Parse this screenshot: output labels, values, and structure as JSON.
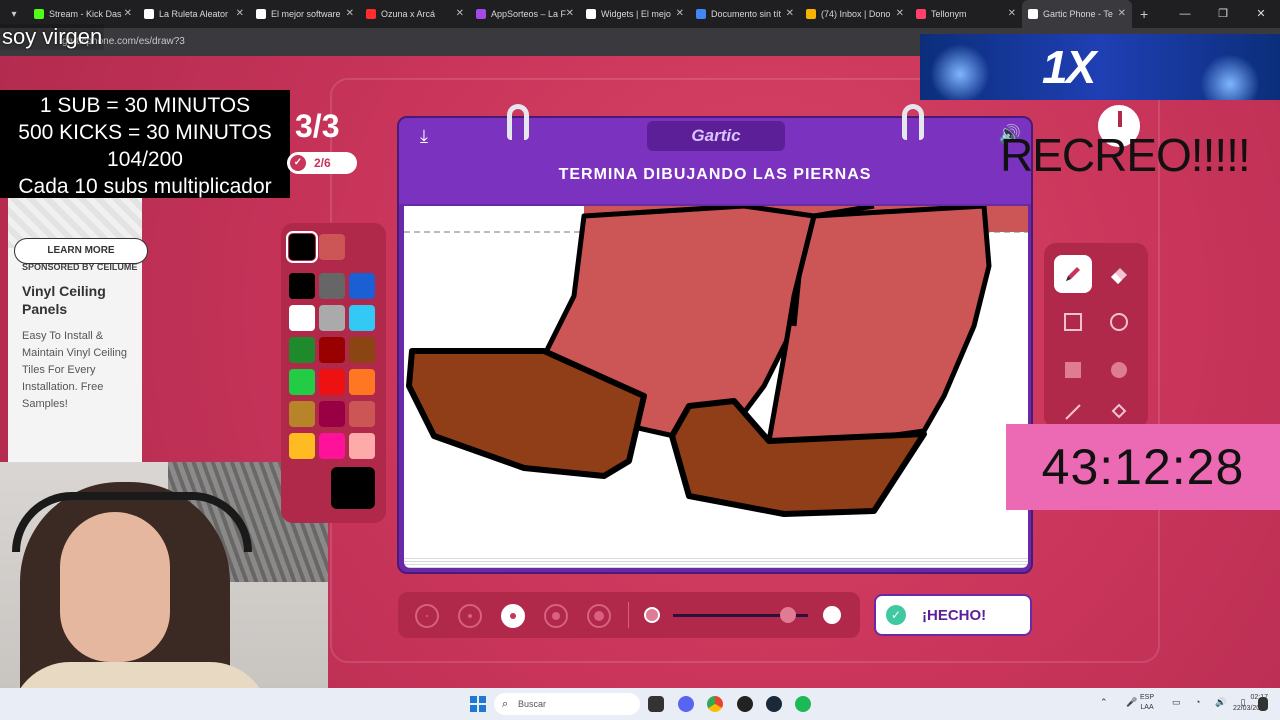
{
  "browser": {
    "tabs": [
      {
        "label": "Stream - Kick Das",
        "color": "#53fc18"
      },
      {
        "label": "La Ruleta Aleator",
        "color": "#ffffff"
      },
      {
        "label": "El mejor software",
        "color": "#ffffff"
      },
      {
        "label": "Ozuna x Arcá",
        "color": "#ff2d2d"
      },
      {
        "label": "AppSorteos – La F",
        "color": "#a349e6"
      },
      {
        "label": "Widgets | El mejo",
        "color": "#ffffff"
      },
      {
        "label": "Documento sin tít",
        "color": "#4285f4"
      },
      {
        "label": "(74) Inbox | Dono",
        "color": "#f6b400"
      },
      {
        "label": "Tellonym",
        "color": "#ff3f6c"
      },
      {
        "label": "Gartic Phone - Te",
        "color": "#ffffff"
      }
    ],
    "url": "garticphone.com/es/draw?3"
  },
  "overlay": {
    "title": "soy virgen",
    "lines": [
      "1 SUB      = 30 MINUTOS",
      "500 KICKS = 30 MINUTOS",
      "104/200",
      "Cada 10 subs multiplicador"
    ]
  },
  "game": {
    "round": "3/3",
    "progress": "2/6",
    "logo": "Gartic",
    "prompt": "TERMINA DIBUJANDO LAS PIERNAS",
    "done_label": "¡HECHO!",
    "selected_brush_index": 2,
    "opacity_level": 0.85,
    "palette": [
      "#000000",
      "#666666",
      "#1b5fd4",
      "#ffffff",
      "#aaaaaa",
      "#33c9f5",
      "#1f8a2c",
      "#990000",
      "#8b4513",
      "#22cc44",
      "#ee1111",
      "#ff7722",
      "#b8842a",
      "#990044",
      "#cc5555",
      "#ffbb22",
      "#ff1199",
      "#ffaaaa"
    ],
    "current_colors": [
      "#000000",
      "#cc5555"
    ],
    "tools": [
      "pen-icon",
      "eraser-icon",
      "rectangle-icon",
      "ellipse-icon",
      "filled-rectangle-icon",
      "filled-ellipse-icon",
      "line-icon",
      "bucket-icon"
    ]
  },
  "ad": {
    "sponsor": "SPONSORED BY CEILUME",
    "title": "Vinyl Ceiling Panels",
    "body": "Easy To Install & Maintain Vinyl Ceiling Tiles For Every Installation. Free Samples!",
    "cta": "LEARN MORE"
  },
  "right_overlay": {
    "brand": "1X",
    "recreo": "RECREO!!!!!",
    "timer": "43:12:28"
  },
  "taskbar": {
    "search_placeholder": "Buscar",
    "lang_top": "ESP",
    "lang_bottom": "LAA",
    "time": "02:17",
    "date": "22/03/2026"
  }
}
